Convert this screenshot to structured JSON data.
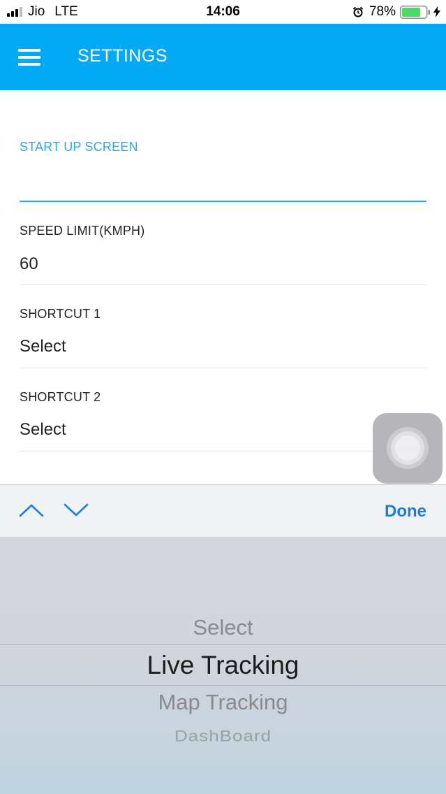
{
  "status_bar": {
    "carrier": "Jio",
    "network": "LTE",
    "time": "14:06",
    "battery_percent": "78%",
    "battery_level": 0.78,
    "icons": [
      "signal-icon",
      "alarm-icon",
      "battery-icon",
      "charging-bolt-icon"
    ]
  },
  "header": {
    "title": "SETTINGS",
    "menu_icon": "hamburger-menu-icon",
    "background_color": "#03a9f4"
  },
  "form": {
    "start_up_screen": {
      "label": "START UP SCREEN",
      "value": ""
    },
    "speed_limit": {
      "label": "SPEED LIMIT(KMPH)",
      "value": "60"
    },
    "shortcut_1": {
      "label": "SHORTCUT 1",
      "value": "Select"
    },
    "shortcut_2": {
      "label": "SHORTCUT 2",
      "value": "Select"
    }
  },
  "toolbar": {
    "prev_icon": "chevron-up-icon",
    "next_icon": "chevron-down-icon",
    "done_label": "Done",
    "done_color": "#1a7ee6"
  },
  "picker": {
    "options": [
      "Select",
      "Live Tracking",
      "Map Tracking",
      "DashBoard"
    ],
    "selected": "Live Tracking"
  },
  "colors": {
    "accent": "#29a9e3"
  }
}
